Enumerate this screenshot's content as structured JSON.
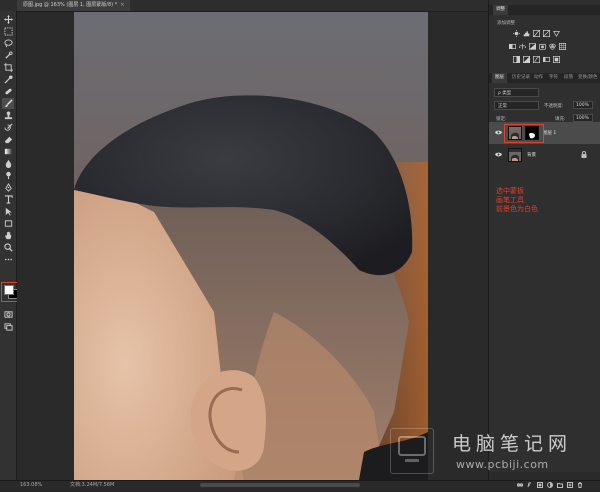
{
  "document_tab": {
    "title": "原图.jpg @ 163% (图层 1, 图层蒙版/8) *",
    "close": "×"
  },
  "toolbar": {
    "tools": [
      "move-tool",
      "marquee-tool",
      "lasso-tool",
      "quick-select-tool",
      "crop-tool",
      "eyedropper-tool",
      "healing-tool",
      "brush-tool",
      "clone-stamp-tool",
      "history-brush-tool",
      "eraser-tool",
      "gradient-tool",
      "blur-tool",
      "dodge-tool",
      "pen-tool",
      "type-tool",
      "path-select-tool",
      "rectangle-tool",
      "hand-tool",
      "zoom-tool",
      "more-tools"
    ],
    "active_tool": "brush-tool",
    "foreground_color": "#ffffff",
    "background_color": "#000000"
  },
  "status": {
    "zoom": "163.08%",
    "doc_size": "文档:3.24M/7.56M"
  },
  "adjustments_panel": {
    "tab_label": "调整",
    "title": "添加调整",
    "icons": [
      "brightness-contrast-icon",
      "levels-icon",
      "curves-icon",
      "exposure-icon",
      "vibrance-icon",
      "hue-saturation-icon",
      "color-balance-icon",
      "black-white-icon",
      "photo-filter-icon",
      "channel-mixer-icon",
      "color-lookup-icon",
      "invert-icon",
      "posterize-icon",
      "threshold-icon",
      "gradient-map-icon",
      "selective-color-icon"
    ]
  },
  "layers_panel": {
    "tabs": [
      "图层",
      "历史记录",
      "动作",
      "字符",
      "段落",
      "变换/颜色"
    ],
    "filter_kind": "ρ 类型",
    "blend_mode": "正常",
    "opacity_label": "不透明度:",
    "opacity_value": "100%",
    "lock_label": "锁定:",
    "fill_label": "填充:",
    "fill_value": "100%",
    "layers": [
      {
        "name": "图层 1",
        "selected": true,
        "has_mask": true
      },
      {
        "name": "背景",
        "selected": false,
        "locked": true
      }
    ]
  },
  "annotation": {
    "lines": [
      "选中蒙板",
      "画笔工具",
      "前景色为白色"
    ],
    "color": "#e0402a"
  },
  "watermark": {
    "text": "电脑笔记网",
    "url": "www.pcbiji.com"
  }
}
